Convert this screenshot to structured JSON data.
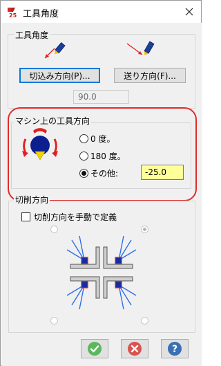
{
  "window": {
    "title": "工具角度"
  },
  "tool_angle_group": {
    "label": "工具角度",
    "plunge_button": "切込み方向(P)...",
    "feed_button": "送り方向(F)...",
    "angle_value": "90.0"
  },
  "machine_group": {
    "label": "マシン上の工具方向",
    "options": [
      {
        "label": "0 度。",
        "checked": false
      },
      {
        "label": "180 度。",
        "checked": false
      },
      {
        "label": "その他:",
        "checked": true
      }
    ],
    "other_value": "-25.0"
  },
  "cut_group": {
    "label": "切削方向",
    "manual_checkbox_label": "切削方向を手動で定義",
    "manual_checked": false
  },
  "footer": {
    "ok_icon": "check-icon",
    "cancel_icon": "x-icon",
    "help_icon": "question-icon"
  },
  "colors": {
    "highlight_outline": "#e02b2b",
    "input_bg": "#ffff99",
    "ok_green": "#5cb85c",
    "cancel_red": "#d9534f",
    "help_blue": "#3a6fb5"
  }
}
